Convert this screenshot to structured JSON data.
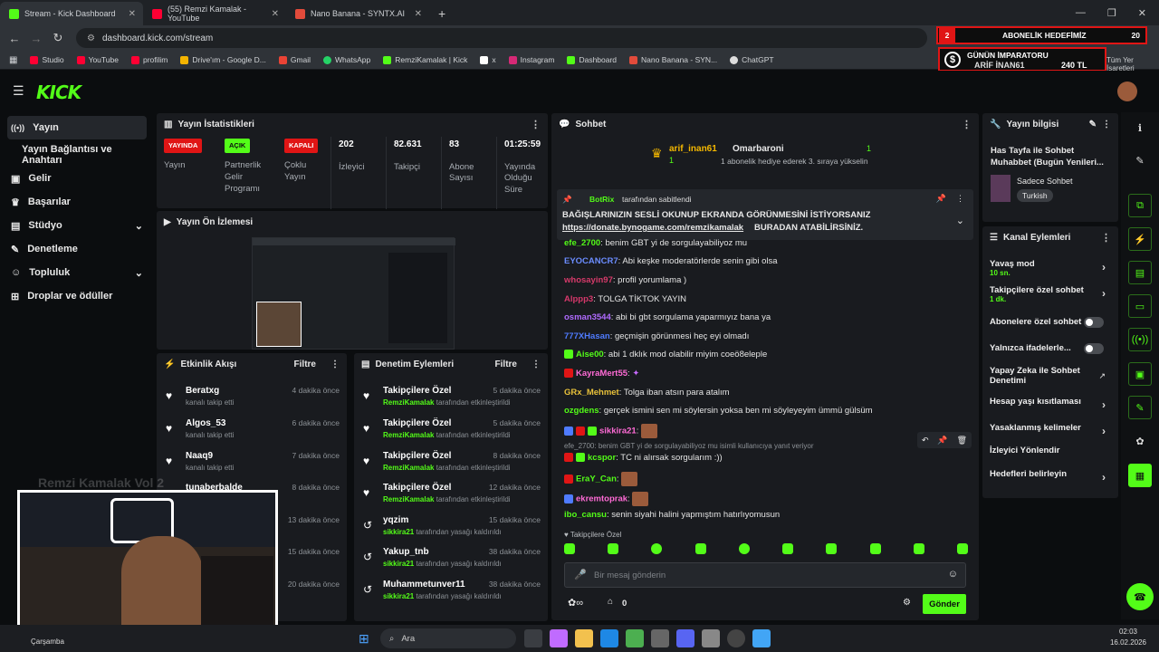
{
  "browser": {
    "tabs": [
      {
        "title": "Stream - Kick Dashboard",
        "color": "#53fc18"
      },
      {
        "title": "(55) Remzi Kamalak - YouTube",
        "color": "#ff0033"
      },
      {
        "title": "Nano Banana - SYNTX.AI",
        "color": "#e24b3b"
      }
    ],
    "url": "dashboard.kick.com/stream",
    "bookmarks": [
      "Studio",
      "YouTube",
      "profilim",
      "Drive'ım - Google D...",
      "Gmail",
      "WhatsApp",
      "RemziKamalak | Kick",
      "x",
      "Instagram",
      "Dashboard",
      "Nano Banana - SYN...",
      "ChatGPT"
    ],
    "bookmarks_right": "Tüm Yer İşaretleri"
  },
  "overlay": {
    "goal_count": "2",
    "goal_label": "ABONELİK HEDEFİMİZ",
    "goal_target": "20",
    "emperor_title": "GÜNÜN İMPARATORU",
    "emperor_name": "ARİF İNAN61",
    "emperor_amount": "240 TL"
  },
  "sidebar": {
    "items": [
      "Yayın",
      "Yayın Bağlantısı ve Anahtarı",
      "Gelir",
      "Başarılar",
      "Stüdyo",
      "Denetleme",
      "Topluluk",
      "Droplar ve ödüller"
    ]
  },
  "stats": {
    "title": "Yayın İstatistikleri",
    "cols": [
      {
        "badge": "YAYINDA",
        "label": "Yayın"
      },
      {
        "badge": "AÇIK",
        "label": "Partnerlik Gelir Programı"
      },
      {
        "badge": "KAPALI",
        "label": "Çoklu Yayın"
      },
      {
        "value": "202",
        "label": "İzleyici"
      },
      {
        "value": "82.631",
        "label": "Takipçi"
      },
      {
        "value": "83",
        "label": "Abone Sayısı"
      },
      {
        "value": "01:25:59",
        "label": "Yayında Olduğu Süre"
      }
    ]
  },
  "preview": {
    "title": "Yayın Ön İzlemesi"
  },
  "activity": {
    "title": "Etkinlik Akışı",
    "filter": "Filtre",
    "items": [
      {
        "name": "Beratxg",
        "sub": "kanalı takip etti",
        "time": "4 dakika önce"
      },
      {
        "name": "Algos_53",
        "sub": "kanalı takip etti",
        "time": "6 dakika önce"
      },
      {
        "name": "Naaq9",
        "sub": "kanalı takip etti",
        "time": "7 dakika önce"
      },
      {
        "name": "tunaberbalde",
        "sub": "",
        "time": "8 dakika önce"
      },
      {
        "name": "",
        "sub": "",
        "time": "13 dakika önce"
      },
      {
        "name": "",
        "sub": "",
        "time": "15 dakika önce"
      },
      {
        "name": "",
        "sub": "",
        "time": "20 dakika önce"
      }
    ]
  },
  "moderation": {
    "title": "Denetim Eylemleri",
    "filter": "Filtre",
    "items": [
      {
        "name": "Takipçilere Özel",
        "user": "RemziKamalak",
        "sub": "tarafından etkinleştirildi",
        "time": "5 dakika önce",
        "icon": "heart"
      },
      {
        "name": "Takipçilere Özel",
        "user": "RemziKamalak",
        "sub": "tarafından etkinleştirildi",
        "time": "5 dakika önce",
        "icon": "heart"
      },
      {
        "name": "Takipçilere Özel",
        "user": "RemziKamalak",
        "sub": "tarafından etkinleştirildi",
        "time": "8 dakika önce",
        "icon": "heart"
      },
      {
        "name": "Takipçilere Özel",
        "user": "RemziKamalak",
        "sub": "tarafından etkinleştirildi",
        "time": "12 dakika önce",
        "icon": "heart"
      },
      {
        "name": "yqzim",
        "user": "sikkira21",
        "sub": "tarafından yasağı kaldırıldı",
        "time": "15 dakika önce",
        "icon": "undo"
      },
      {
        "name": "Yakup_tnb",
        "user": "sikkira21",
        "sub": "tarafından yasağı kaldırıldı",
        "time": "38 dakika önce",
        "icon": "undo"
      },
      {
        "name": "Muhammetunver11",
        "user": "sikkira21",
        "sub": "tarafından yasağı kaldırıldı",
        "time": "38 dakika önce",
        "icon": "undo"
      }
    ]
  },
  "chat": {
    "title": "Sohbet",
    "gifter_name": "arif_inan61",
    "gifter_count": "1",
    "gifted_to": "Omarbaroni",
    "gift_count": "1",
    "gift_text": "1 abonelik hediye ederek 3. sıraya yükselin",
    "pinned_by": "BotRix",
    "pinned_suffix": "tarafından sabitlendi",
    "pinned_text": "BAĞIŞLARINIZIN SESLİ OKUNUP EKRANDA GÖRÜNMESİNİ İSTİYORSANIZ",
    "pinned_link": "https://donate.bynogame.com/remzikamalak",
    "pinned_after": "BURADAN ATABİLİRSİNİZ.",
    "messages": [
      {
        "user": "efe_2700",
        "color": "#53fc18",
        "text": "benim GBT yi de sorgulayabiliyoz mu"
      },
      {
        "user": "EYOCANCR7",
        "color": "#6b8cff",
        "text": "Abi keşke moderatörlerde senin gibi olsa"
      },
      {
        "user": "whosayin97",
        "color": "#d63a6a",
        "text": "profil yorumlama )"
      },
      {
        "user": "Alppp3",
        "color": "#d6386b",
        "text": "TOLGA TİKTOK YAYIN"
      },
      {
        "user": "osman3544",
        "color": "#b06bff",
        "text": "abi bi gbt sorgulama yaparmıyız bana ya"
      },
      {
        "user": "777XHasan",
        "color": "#4f7bff",
        "text": "geçmişin görünmesi heç eyi olmadı"
      },
      {
        "user": "Aise00",
        "color": "#53fc18",
        "text": "abi 1 dklık mod olabilir miyim coeö8eleple"
      },
      {
        "user": "KayraMert55",
        "color": "#ff6bd6",
        "text": ""
      },
      {
        "user": "GRx_Mehmet",
        "color": "#e8c13a",
        "text": "Tolga iban atsın para atalım"
      },
      {
        "user": "ozgdens",
        "color": "#53fc18",
        "text": "gerçek ismini sen mi söylersin yoksa ben mi söyleyeyim ümmü gülsüm"
      },
      {
        "user": "sikkira21",
        "color": "#ff6bd6",
        "text": ""
      },
      {
        "user": "kcspor",
        "color": "#53fc18",
        "text": "TC ni alırsak sorgularım :))"
      },
      {
        "user": "EraY_Can",
        "color": "#53fc18",
        "text": ""
      },
      {
        "user": "ekremtoprak",
        "color": "#ff6bd6",
        "text": ""
      },
      {
        "user": "ibo_cansu",
        "color": "#53fc18",
        "text": "senin siyahi halini yapmıştım hatırlıyomusun"
      }
    ],
    "reply_hint": "efe_2700: benim GBT yi de sorgulayabiliyoz mu isimli kullanıcıya yanıt veriyor",
    "followers_only": "Takipçilere Özel",
    "input_placeholder": "Bir mesaj gönderin",
    "send": "Gönder",
    "points": "0"
  },
  "stream_info": {
    "title": "Yayın bilgisi",
    "stream_title": "Has Tayfa ile Sohbet Muhabbet (Bugün Yenileri...",
    "category": "Sadece Sohbet",
    "language": "Turkish"
  },
  "channel_actions": {
    "title": "Kanal Eylemleri",
    "items": [
      {
        "label": "Yavaş mod",
        "sub": "10 sn.",
        "kind": "chev"
      },
      {
        "label": "Takipçilere özel sohbet",
        "sub": "1 dk.",
        "kind": "chev"
      },
      {
        "label": "Abonelere özel sohbet",
        "sub": "",
        "kind": "toggle"
      },
      {
        "label": "Yalnızca ifadelerle...",
        "sub": "",
        "kind": "toggle"
      },
      {
        "label": "Yapay Zeka ile Sohbet Denetimi",
        "sub": "",
        "kind": "ext"
      },
      {
        "label": "Hesap yaşı kısıtlaması",
        "sub": "",
        "kind": "chev"
      },
      {
        "label": "Yasaklanmış kelimeler",
        "sub": "",
        "kind": "chev"
      },
      {
        "label": "İzleyici Yönlendir",
        "sub": "",
        "kind": "none"
      },
      {
        "label": "Hedefleri belirleyin",
        "sub": "",
        "kind": "chev"
      }
    ]
  },
  "webcam": {
    "watermark": "Remzi Kamalak Vol 2"
  },
  "taskbar": {
    "search": "Ara",
    "day": "Çarşamba",
    "time": "02:03",
    "date": "16.02.2026"
  }
}
